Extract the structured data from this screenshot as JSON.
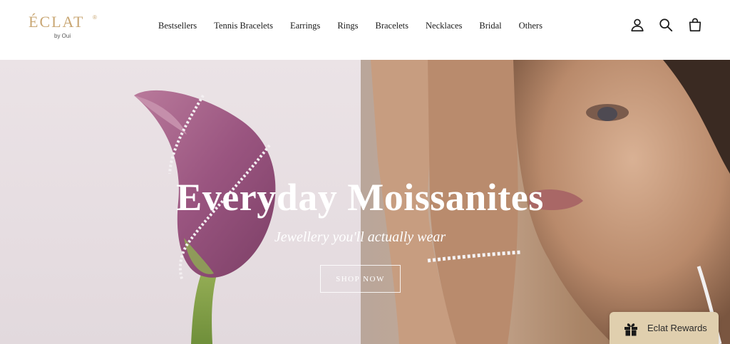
{
  "brand": {
    "name": "ÉCLAT",
    "registered": "®",
    "tagline": "by Oui",
    "color": "#c9a774"
  },
  "nav": {
    "items": [
      {
        "label": "Bestsellers"
      },
      {
        "label": "Tennis Bracelets"
      },
      {
        "label": "Earrings"
      },
      {
        "label": "Rings"
      },
      {
        "label": "Bracelets"
      },
      {
        "label": "Necklaces"
      },
      {
        "label": "Bridal"
      },
      {
        "label": "Others"
      }
    ]
  },
  "header_icons": [
    "account-icon",
    "search-icon",
    "cart-icon"
  ],
  "hero": {
    "title": "Everyday Moissanites",
    "subtitle": "Jewellery you'll actually wear",
    "cta": "SHOP NOW"
  },
  "rewards": {
    "label": "Eclat Rewards",
    "icon": "gift-icon",
    "background": "#e0cfae"
  }
}
